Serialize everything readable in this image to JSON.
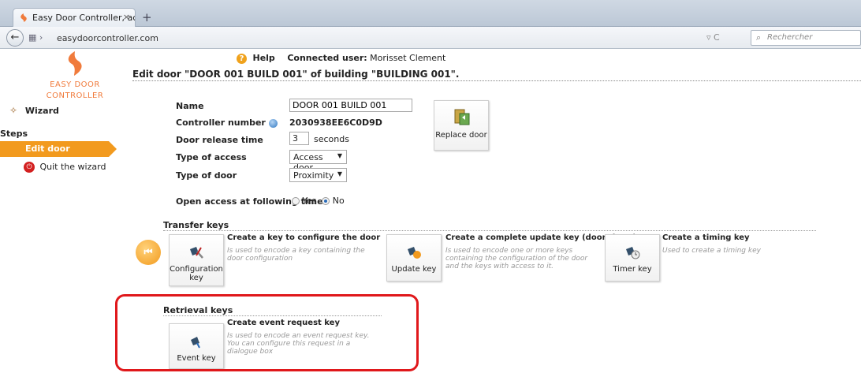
{
  "browser": {
    "tab_title": "Easy Door Controller, acces...",
    "tab_close": "×",
    "new_tab": "+",
    "url": "easydoorcontroller.com",
    "search_placeholder": "Rechercher",
    "reload": "C"
  },
  "header": {
    "help_label": "Help",
    "connected_label": "Connected user:",
    "user_name": "Morisset Clement"
  },
  "sidebar": {
    "logo_line1": "EASY DOOR",
    "logo_line2": "CONTROLLER",
    "wizard_label": "Wizard",
    "steps_label": "Steps",
    "current_step": "Edit door",
    "quit_label": "Quit the wizard"
  },
  "main": {
    "page_title": "Edit door \"DOOR 001 BUILD 001\" of building \"BUILDING 001\".",
    "form": {
      "name_label": "Name",
      "name_value": "DOOR 001 BUILD 001",
      "controller_label": "Controller number",
      "controller_value": "2030938EE6C0D9D",
      "release_label": "Door release time",
      "release_value": "3",
      "release_unit": "seconds",
      "access_type_label": "Type of access",
      "access_type_value": "Access door",
      "door_type_label": "Type of door",
      "door_type_value": "Proximity",
      "open_access_label": "Open access at following times",
      "yes_label": "Yes",
      "no_label": "No",
      "open_access_selected": "No"
    },
    "replace_door_label": "Replace door",
    "transfer": {
      "title": "Transfer keys",
      "keys": [
        {
          "button": "Configuration key",
          "title": "Create a key to configure the door",
          "desc": "Is used to encode a key containing the door configuration"
        },
        {
          "button": "Update key",
          "title": "Create a complete update key (door+keys)",
          "desc": "Is used to encode one or more keys containing the configuration of the door and the keys with access to it."
        },
        {
          "button": "Timer key",
          "title": "Create a timing key",
          "desc": "Used to create a timing key"
        }
      ]
    },
    "retrieval": {
      "title": "Retrieval keys",
      "keys": [
        {
          "button": "Event key",
          "title": "Create event request key",
          "desc": "Is used to encode an event request key. You can configure this request in a dialogue box"
        }
      ]
    }
  },
  "colors": {
    "accent": "#f29a1e",
    "highlight": "#e0181b",
    "logo": "#f07b3c"
  }
}
